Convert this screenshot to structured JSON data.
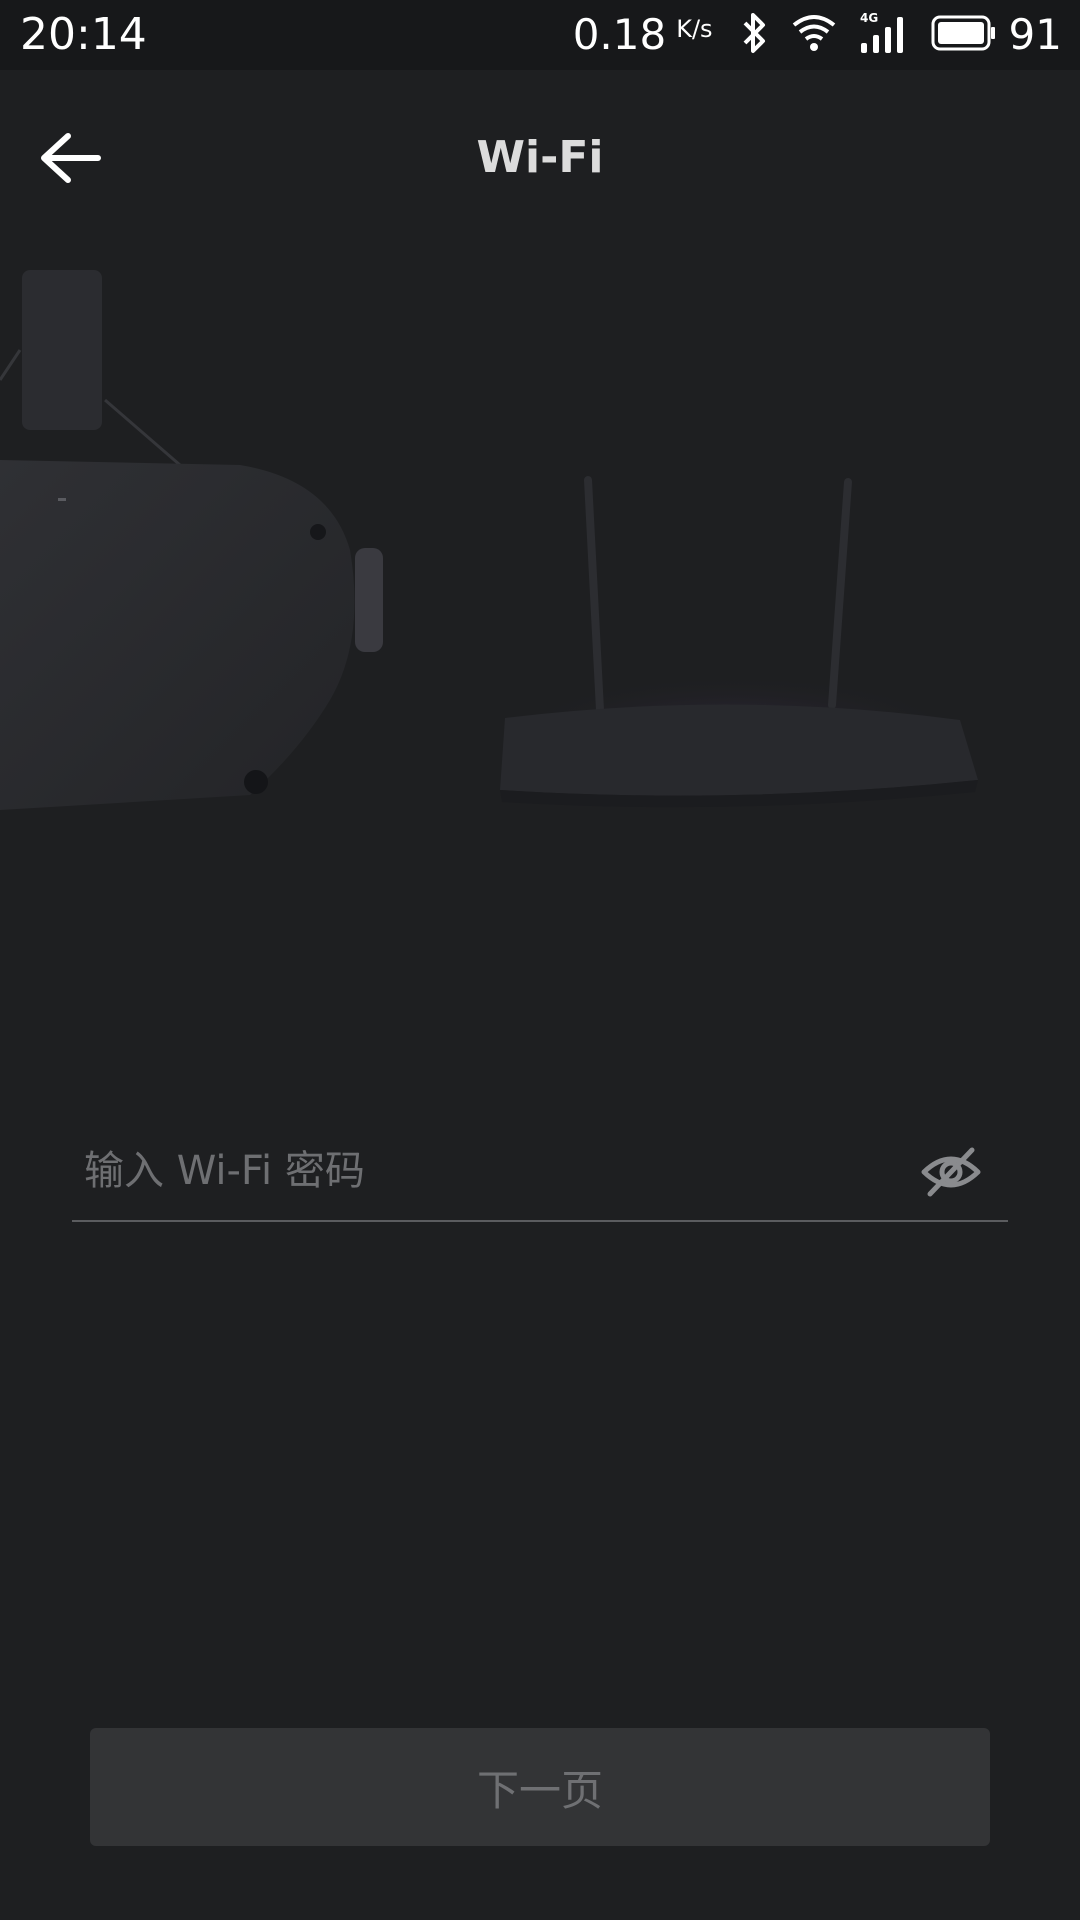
{
  "status_bar": {
    "time": "20:14",
    "net_speed": "0.18",
    "net_unit": "K/s",
    "network_type": "4G",
    "battery_percent": "91",
    "icons": [
      "bluetooth-icon",
      "wifi-signal-icon",
      "cellular-signal-icon",
      "battery-icon"
    ]
  },
  "header": {
    "title": "Wi-Fi",
    "back_icon": "arrow-left-icon"
  },
  "illustration": {
    "items": [
      "vr-headset-image",
      "router-image"
    ]
  },
  "password_field": {
    "value": "",
    "placeholder": "输入 Wi-Fi 密码",
    "toggle_icon": "eye-off-icon"
  },
  "next_button": {
    "label": "下一页"
  },
  "colors": {
    "background": "#1e1f21",
    "status_bar": "#17181a",
    "button_bg": "#333436",
    "button_text": "#6f7073",
    "placeholder": "#6e6f72"
  }
}
